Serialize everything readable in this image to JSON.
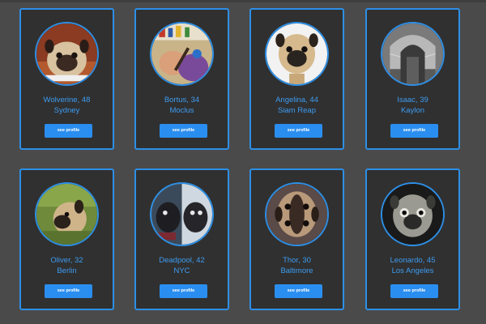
{
  "profiles": [
    {
      "name_age": "Wolverine, 48",
      "city": "Sydney",
      "button": "see profile",
      "photo_icon": "pug-photo"
    },
    {
      "name_age": "Bortus, 34",
      "city": "Moclus",
      "button": "see profile",
      "photo_icon": "painting-photo"
    },
    {
      "name_age": "Angelina, 44",
      "city": "Siam Reap",
      "button": "see profile",
      "photo_icon": "pug-photo"
    },
    {
      "name_age": "Isaac, 39",
      "city": "Kaylon",
      "button": "see profile",
      "photo_icon": "corridor-photo"
    },
    {
      "name_age": "Oliver, 32",
      "city": "Berlin",
      "button": "see profile",
      "photo_icon": "pug-photo"
    },
    {
      "name_age": "Deadpool, 42",
      "city": "NYC",
      "button": "see profile",
      "photo_icon": "pug-photo"
    },
    {
      "name_age": "Thor, 30",
      "city": "Baltimore",
      "button": "see profile",
      "photo_icon": "pug-photo"
    },
    {
      "name_age": "Leonardo, 45",
      "city": "Los Angeles",
      "button": "see profile",
      "photo_icon": "pug-photo"
    }
  ],
  "colors": {
    "background": "#4a4a4a",
    "card": "#303030",
    "accent": "#2d8fe6",
    "text": "#3d9cf2",
    "button_text": "#ffffff"
  }
}
